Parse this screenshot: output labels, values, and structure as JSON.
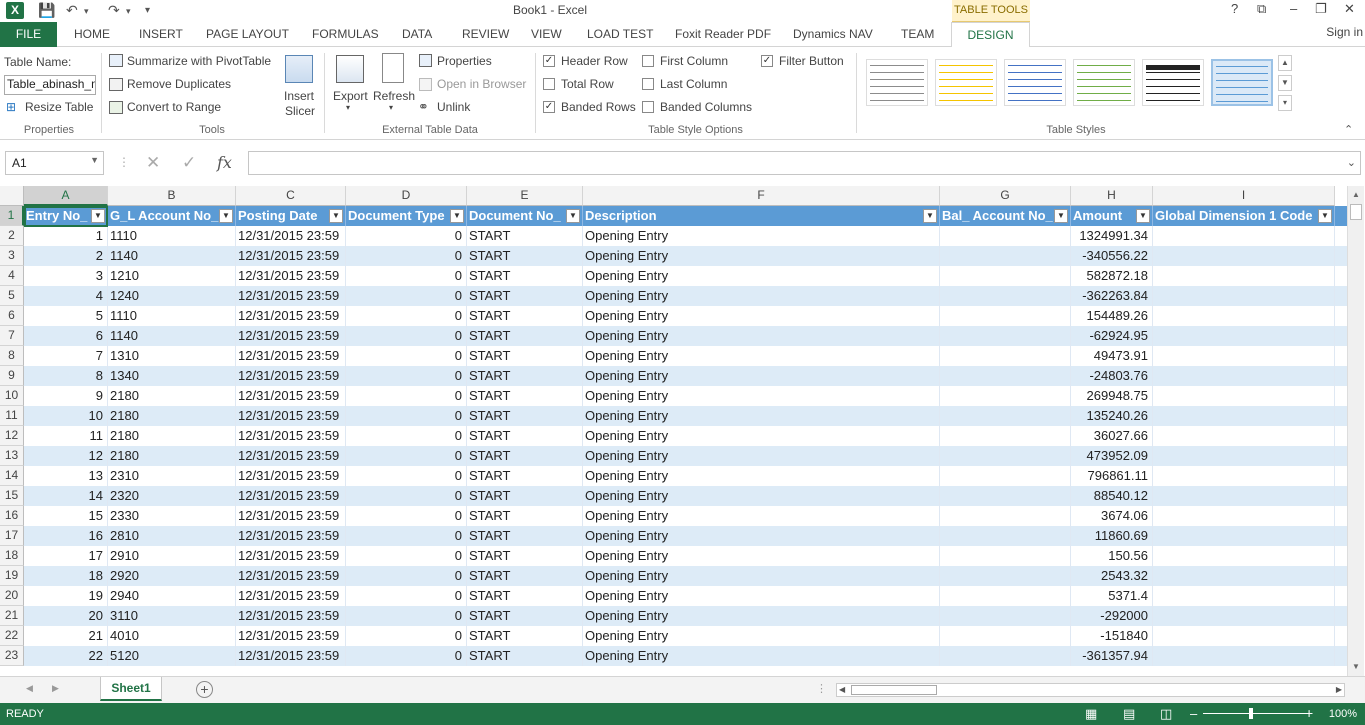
{
  "app": {
    "logo": "X",
    "title": "Book1 - Excel",
    "context_tab_group": "TABLE TOOLS",
    "signin": "Sign in",
    "window_controls": [
      "?",
      "⧉",
      "–",
      "❐",
      "✕"
    ]
  },
  "tabs": [
    "HOME",
    "INSERT",
    "PAGE LAYOUT",
    "FORMULAS",
    "DATA",
    "REVIEW",
    "VIEW",
    "LOAD TEST",
    "Foxit Reader PDF",
    "Dynamics NAV",
    "TEAM"
  ],
  "file_tab": "FILE",
  "design_tab": "DESIGN",
  "ribbon": {
    "properties": {
      "label": "Properties",
      "table_name_label": "Table Name:",
      "table_name_value": "Table_abinash_m",
      "resize_table": "Resize Table"
    },
    "tools": {
      "label": "Tools",
      "summarize": "Summarize with PivotTable",
      "remove_duplicates": "Remove Duplicates",
      "convert_to_range": "Convert to Range",
      "insert_slicer_1": "Insert",
      "insert_slicer_2": "Slicer"
    },
    "external": {
      "label": "External Table Data",
      "export": "Export",
      "refresh": "Refresh",
      "properties": "Properties",
      "open_in_browser": "Open in Browser",
      "unlink": "Unlink"
    },
    "style_options": {
      "label": "Table Style Options",
      "header_row": "Header Row",
      "total_row": "Total Row",
      "banded_rows": "Banded Rows",
      "first_column": "First Column",
      "last_column": "Last Column",
      "banded_columns": "Banded Columns",
      "filter_button": "Filter Button",
      "checked": {
        "header_row": true,
        "total_row": false,
        "banded_rows": true,
        "first_column": false,
        "last_column": false,
        "banded_columns": false,
        "filter_button": true
      }
    },
    "table_styles": {
      "label": "Table Styles",
      "swatch_colors": [
        "#8c8c8c",
        "#f5c400",
        "#4472c4",
        "#70ad47",
        "#222222",
        "#5b9bd5"
      ]
    }
  },
  "formula_bar": {
    "name_box": "A1",
    "cancel": "✕",
    "enter": "✓",
    "fx": "fx",
    "value": ""
  },
  "grid": {
    "columns": [
      "A",
      "B",
      "C",
      "D",
      "E",
      "F",
      "G",
      "H",
      "I"
    ],
    "headers": [
      "Entry No_",
      "G_L Account No_",
      "Posting Date",
      "Document Type",
      "Document No_",
      "Description",
      "Bal_ Account No_",
      "Amount",
      "Global Dimension 1 Code"
    ],
    "row_numbers": [
      "1",
      "2",
      "3",
      "4",
      "5",
      "6",
      "7",
      "8",
      "9",
      "10",
      "11",
      "12",
      "13",
      "14",
      "15",
      "16",
      "17",
      "18",
      "19",
      "20",
      "21",
      "22",
      "23"
    ],
    "rows": [
      [
        "1",
        "1110",
        "12/31/2015 23:59",
        "0",
        "START",
        "Opening Entry",
        "",
        "1324991.34",
        ""
      ],
      [
        "2",
        "1140",
        "12/31/2015 23:59",
        "0",
        "START",
        "Opening Entry",
        "",
        "-340556.22",
        ""
      ],
      [
        "3",
        "1210",
        "12/31/2015 23:59",
        "0",
        "START",
        "Opening Entry",
        "",
        "582872.18",
        ""
      ],
      [
        "4",
        "1240",
        "12/31/2015 23:59",
        "0",
        "START",
        "Opening Entry",
        "",
        "-362263.84",
        ""
      ],
      [
        "5",
        "1110",
        "12/31/2015 23:59",
        "0",
        "START",
        "Opening Entry",
        "",
        "154489.26",
        ""
      ],
      [
        "6",
        "1140",
        "12/31/2015 23:59",
        "0",
        "START",
        "Opening Entry",
        "",
        "-62924.95",
        ""
      ],
      [
        "7",
        "1310",
        "12/31/2015 23:59",
        "0",
        "START",
        "Opening Entry",
        "",
        "49473.91",
        ""
      ],
      [
        "8",
        "1340",
        "12/31/2015 23:59",
        "0",
        "START",
        "Opening Entry",
        "",
        "-24803.76",
        ""
      ],
      [
        "9",
        "2180",
        "12/31/2015 23:59",
        "0",
        "START",
        "Opening Entry",
        "",
        "269948.75",
        ""
      ],
      [
        "10",
        "2180",
        "12/31/2015 23:59",
        "0",
        "START",
        "Opening Entry",
        "",
        "135240.26",
        ""
      ],
      [
        "11",
        "2180",
        "12/31/2015 23:59",
        "0",
        "START",
        "Opening Entry",
        "",
        "36027.66",
        ""
      ],
      [
        "12",
        "2180",
        "12/31/2015 23:59",
        "0",
        "START",
        "Opening Entry",
        "",
        "473952.09",
        ""
      ],
      [
        "13",
        "2310",
        "12/31/2015 23:59",
        "0",
        "START",
        "Opening Entry",
        "",
        "796861.11",
        ""
      ],
      [
        "14",
        "2320",
        "12/31/2015 23:59",
        "0",
        "START",
        "Opening Entry",
        "",
        "88540.12",
        ""
      ],
      [
        "15",
        "2330",
        "12/31/2015 23:59",
        "0",
        "START",
        "Opening Entry",
        "",
        "3674.06",
        ""
      ],
      [
        "16",
        "2810",
        "12/31/2015 23:59",
        "0",
        "START",
        "Opening Entry",
        "",
        "11860.69",
        ""
      ],
      [
        "17",
        "2910",
        "12/31/2015 23:59",
        "0",
        "START",
        "Opening Entry",
        "",
        "150.56",
        ""
      ],
      [
        "18",
        "2920",
        "12/31/2015 23:59",
        "0",
        "START",
        "Opening Entry",
        "",
        "2543.32",
        ""
      ],
      [
        "19",
        "2940",
        "12/31/2015 23:59",
        "0",
        "START",
        "Opening Entry",
        "",
        "5371.4",
        ""
      ],
      [
        "20",
        "3110",
        "12/31/2015 23:59",
        "0",
        "START",
        "Opening Entry",
        "",
        "-292000",
        ""
      ],
      [
        "21",
        "4010",
        "12/31/2015 23:59",
        "0",
        "START",
        "Opening Entry",
        "",
        "-151840",
        ""
      ],
      [
        "22",
        "5120",
        "12/31/2015 23:59",
        "0",
        "START",
        "Opening Entry",
        "",
        "-361357.94",
        ""
      ]
    ]
  },
  "sheets": {
    "active": "Sheet1",
    "add": "+"
  },
  "status": {
    "ready": "READY",
    "zoom": "100%",
    "zoom_minus": "–",
    "zoom_plus": "+"
  },
  "colors": {
    "accent": "#217346",
    "table_header": "#5b9bd5",
    "band": "#ddebf7"
  }
}
